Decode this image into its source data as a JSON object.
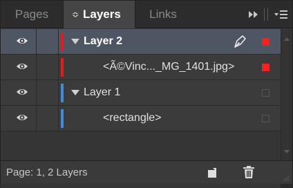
{
  "tabs": {
    "pages": "Pages",
    "layers": "Layers",
    "links": "Links",
    "layers_sort_glyph": "≎"
  },
  "panel_controls": {
    "expand_glyph": "▸▸",
    "menu_glyph": "▾≡"
  },
  "rows": [
    {
      "label": "Layer 2",
      "type": "layer",
      "selected": true,
      "expanded": true,
      "layer_color": "#e31b1b",
      "visible": true,
      "target_square": "filled"
    },
    {
      "label": "<Ã©Vinc..._MG_1401.jpg>",
      "type": "object",
      "selected": false,
      "layer_color": "#e31b1b",
      "visible": true,
      "target_square": "filled"
    },
    {
      "label": "Layer 1",
      "type": "layer",
      "selected": false,
      "expanded": true,
      "layer_color": "#3d8ddb",
      "visible": true,
      "target_square": "empty"
    },
    {
      "label": "<rectangle>",
      "type": "object",
      "selected": false,
      "layer_color": "#3d8ddb",
      "visible": true,
      "target_square": "empty"
    }
  ],
  "footer": {
    "status": "Page: 1, 2 Layers"
  },
  "colors": {
    "selection_bg": "#4e5563",
    "active_indicator": "#ff1e1e"
  }
}
